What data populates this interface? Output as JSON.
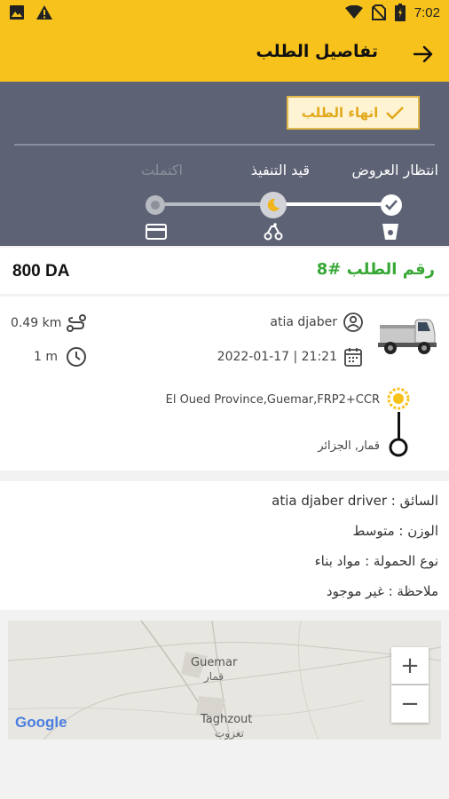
{
  "status_bar": {
    "time": "7:02"
  },
  "app_bar": {
    "title": "تفاصيل الطلب"
  },
  "actions": {
    "end_order": "انهاء الطلب"
  },
  "steps": [
    {
      "label": "انتظار العروض",
      "state": "done"
    },
    {
      "label": "قيد التنفيذ",
      "state": "active"
    },
    {
      "label": "اكتملت",
      "state": "pending"
    }
  ],
  "order": {
    "price": "800 DA",
    "number": "رقم الطلب #8"
  },
  "trip": {
    "distance": "0.49 km",
    "duration": "1 m",
    "customer": "atia djaber",
    "datetime": "2022-01-17 | 21:21",
    "pickup": "El Oued Province,Guemar,FRP2+CCR",
    "dropoff": "قمار, الجزائر"
  },
  "details": {
    "driver": "السائق :  atia djaber driver",
    "weight": "الوزن :  متوسط",
    "load_type": "نوع الحمولة :  مواد بناء",
    "note": "ملاحظة :  غير موجود"
  },
  "map": {
    "label_1": "Guemar",
    "label_1_ar": "قمار",
    "label_2": "Taghzout",
    "label_2_ar": "تغزوت",
    "google": "Google",
    "zoom_in": "+",
    "zoom_out": "−"
  },
  "colors": {
    "accent": "#f8c21c",
    "panel": "#5d6275",
    "order_number": "#37a836"
  }
}
